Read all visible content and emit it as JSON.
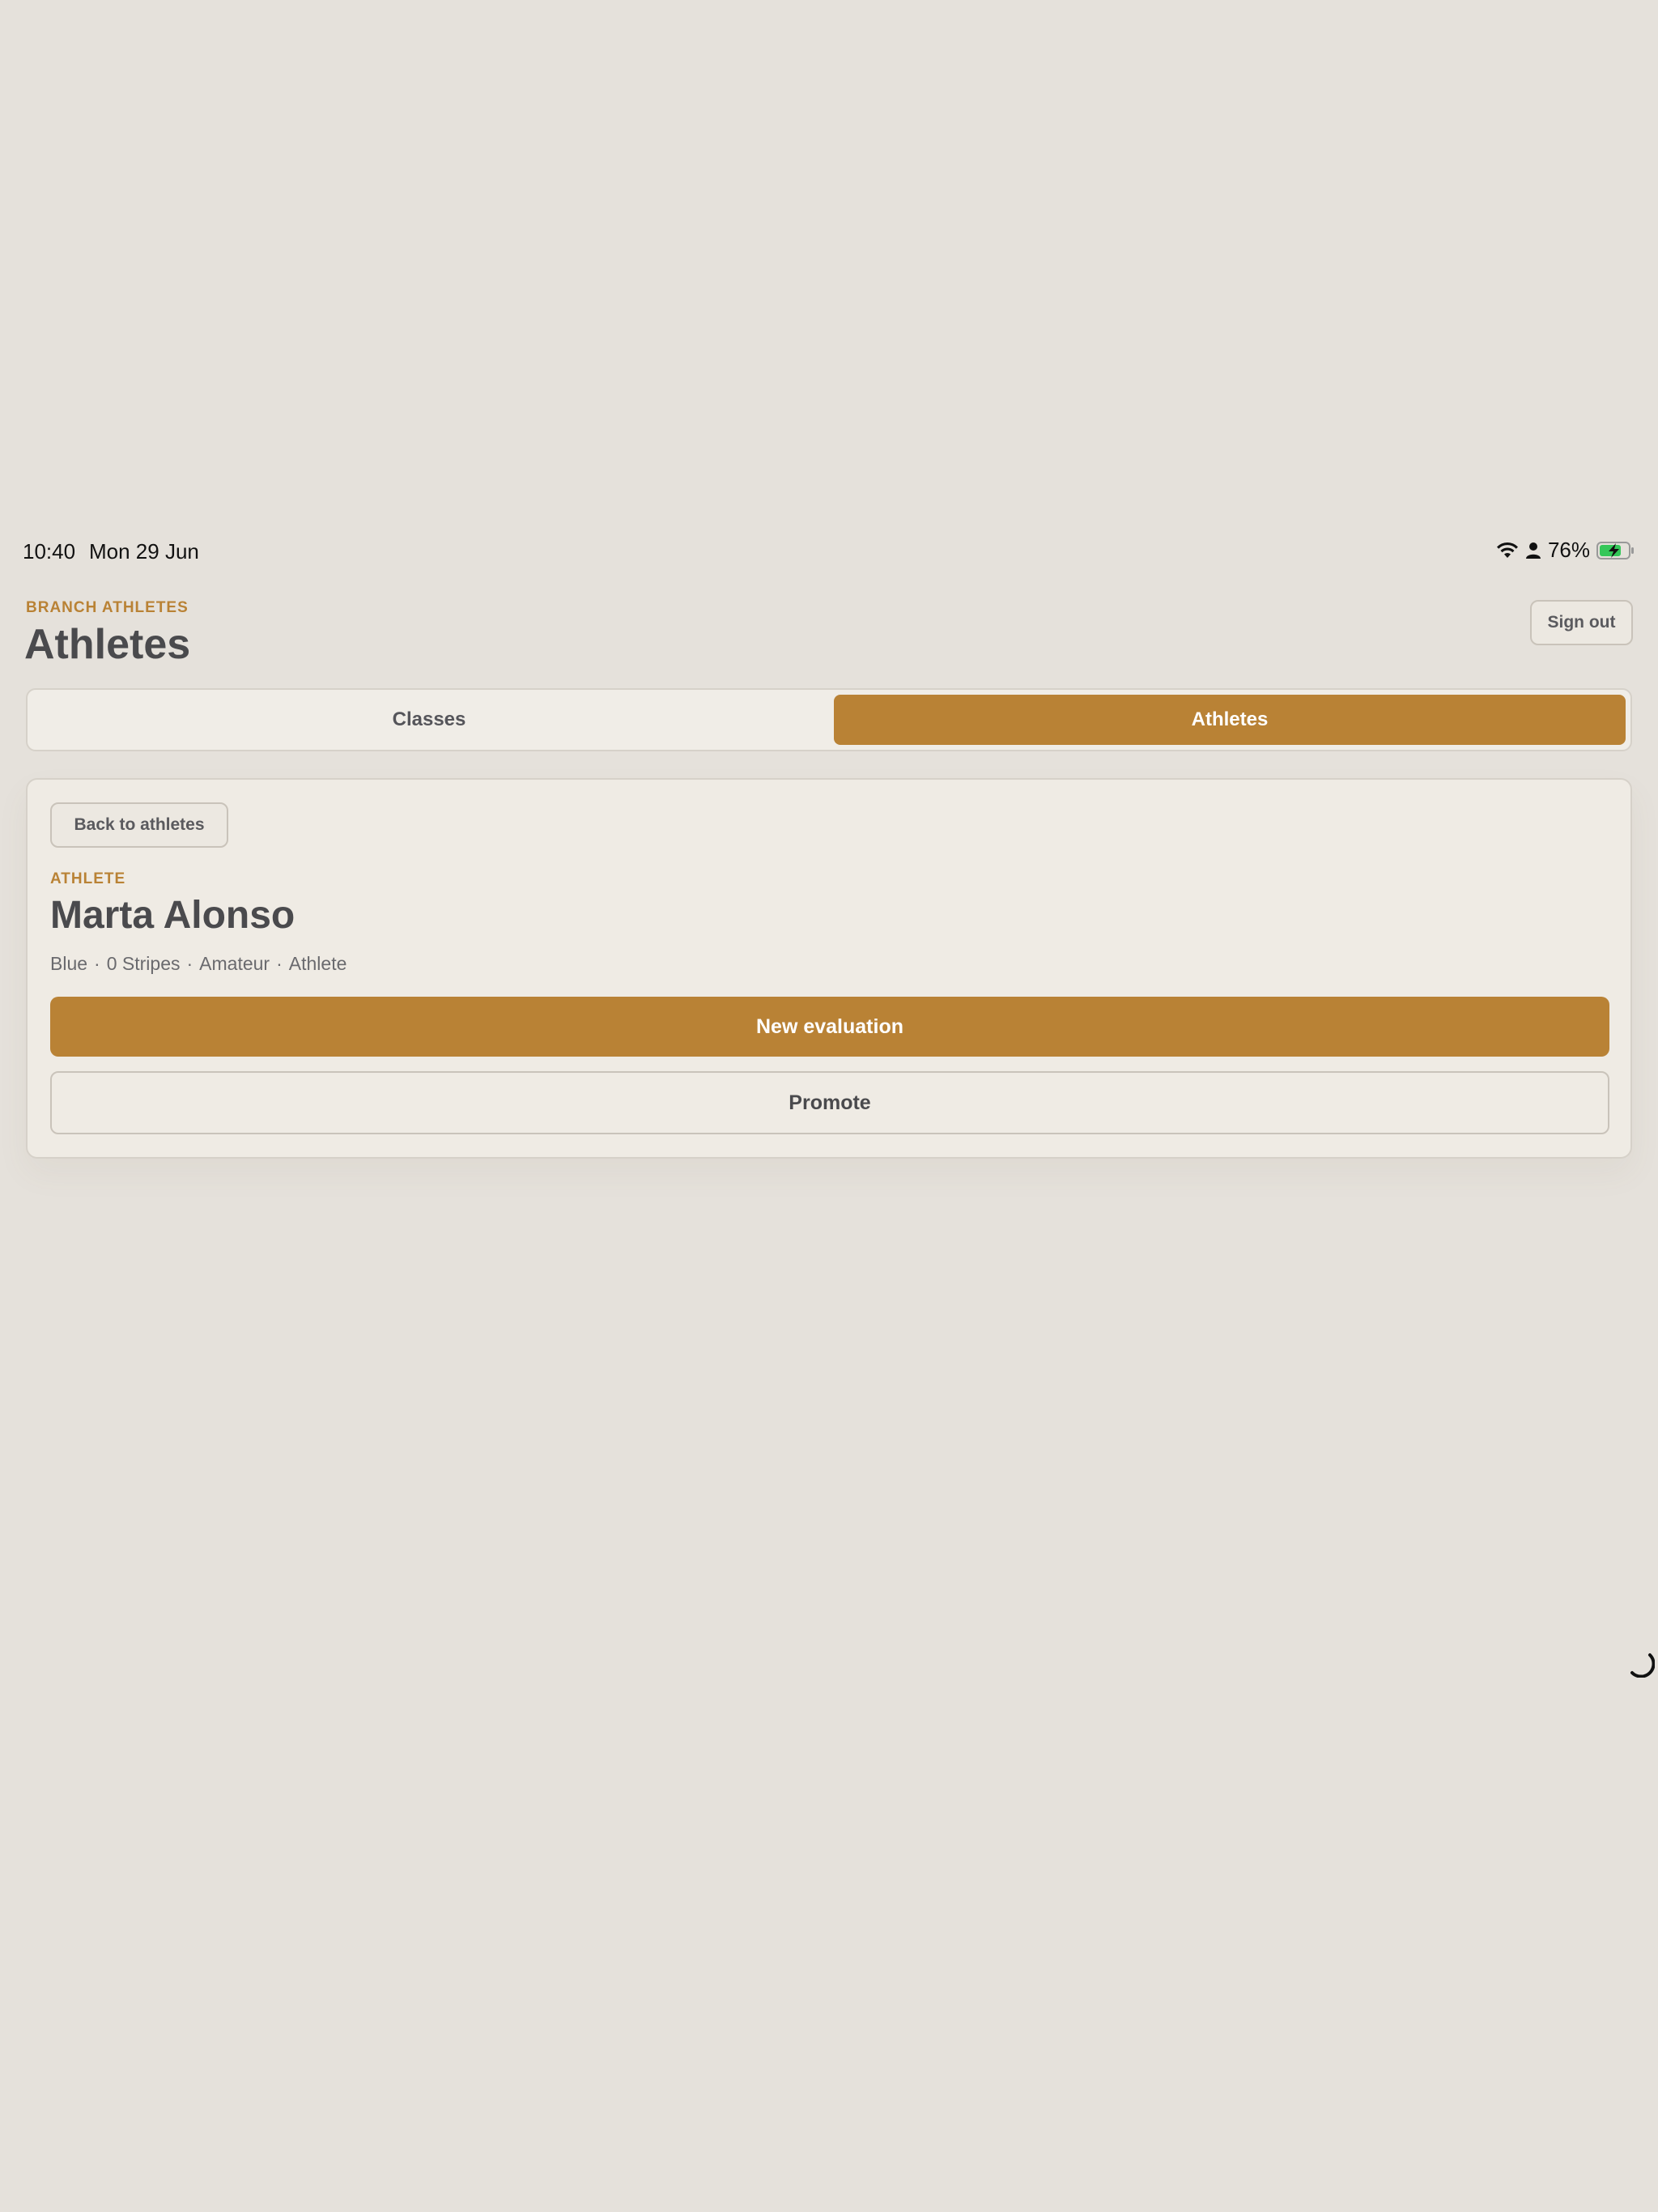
{
  "status_bar": {
    "time": "10:40",
    "date": "Mon 29 Jun",
    "battery": "76%",
    "icons": [
      "wifi-icon",
      "person-icon",
      "battery-charging-icon"
    ]
  },
  "header": {
    "eyebrow": "BRANCH ATHLETES",
    "title": "Athletes",
    "sign_out": "Sign out"
  },
  "tabs": [
    {
      "label": "Classes",
      "selected": false
    },
    {
      "label": "Athletes",
      "selected": true
    }
  ],
  "athlete": {
    "back_label": "Back to athletes",
    "eyebrow": "ATHLETE",
    "name": "Marta Alonso",
    "meta": [
      "Blue",
      "0 Stripes",
      "Amateur",
      "Athlete"
    ],
    "meta_separator": "·"
  },
  "actions": {
    "primary": "New evaluation",
    "secondary": "Promote"
  },
  "colors": {
    "accent": "#b98235",
    "background": "#e5e1db",
    "card": "#efebe4",
    "text": "#4a4a4d",
    "battery_green": "#34c759"
  }
}
